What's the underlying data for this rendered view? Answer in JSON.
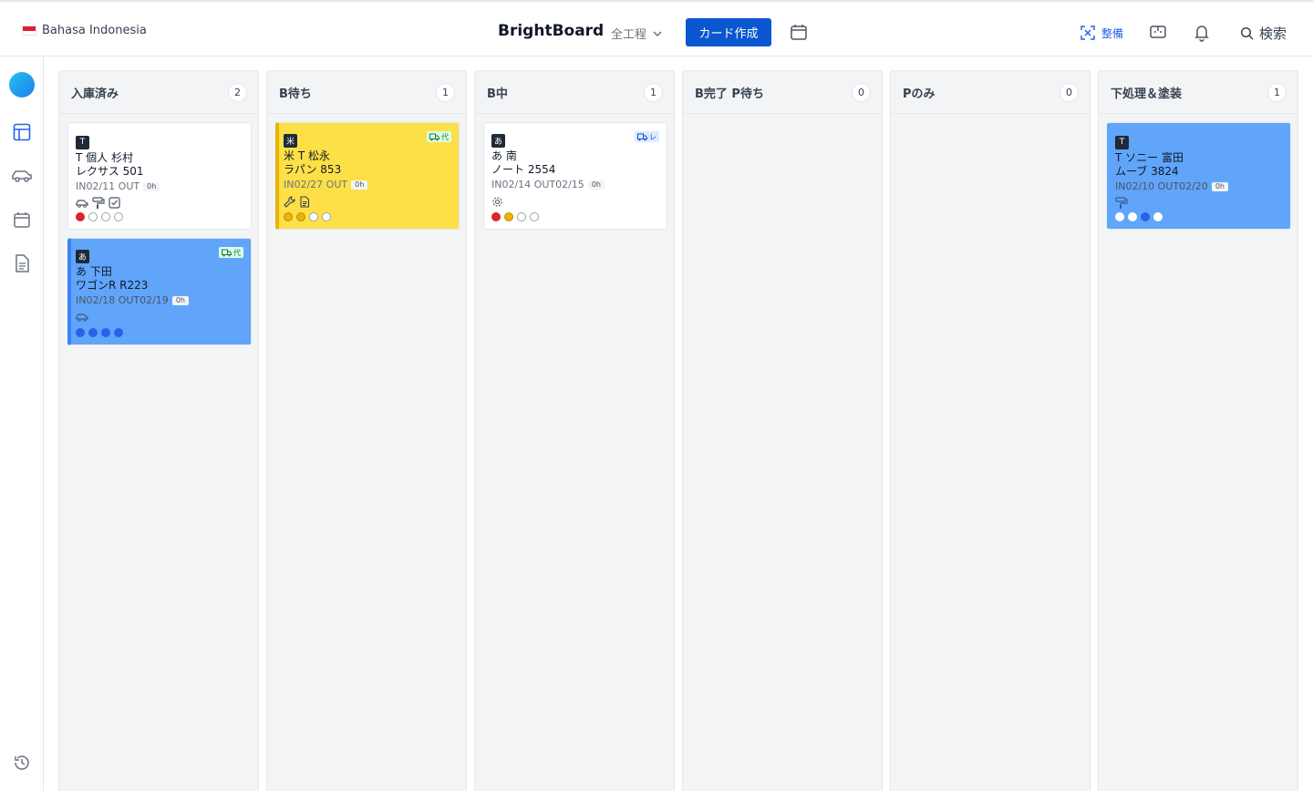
{
  "header": {
    "language": "Bahasa Indonesia",
    "brand": "BrightBoard",
    "stage_filter": "全工程",
    "create_button": "カード作成",
    "maintenance_label": "整備",
    "search_label": "検索"
  },
  "colors": {
    "primary": "#0b57d0",
    "card_yellow": "#fde047",
    "card_blue": "#60a5fa",
    "dot_red": "#dc2626",
    "dot_yellow": "#eab308",
    "dot_blue": "#2563eb"
  },
  "columns": [
    {
      "title": "入庫済み",
      "count": "2",
      "cards": [
        {
          "badge": "T",
          "line1": "T 個人 杉村",
          "line2": "レクサス 501",
          "dates": "IN02/11 OUT",
          "hours": "0h"
        },
        {
          "badge": "あ",
          "tag": "代",
          "line1": "あ 下田",
          "line2": "ワゴンR R223",
          "dates": "IN02/18 OUT02/19",
          "hours": "0h"
        }
      ]
    },
    {
      "title": "B待ち",
      "count": "1",
      "cards": [
        {
          "badge": "米",
          "tag": "代",
          "line1": "米 T 松永",
          "line2": "ラパン 853",
          "dates": "IN02/27 OUT",
          "hours": "0h"
        }
      ]
    },
    {
      "title": "B中",
      "count": "1",
      "cards": [
        {
          "badge": "あ",
          "tag": "レ",
          "line1": "あ 南",
          "line2": "ノート 2554",
          "dates": "IN02/14 OUT02/15",
          "hours": "0h"
        }
      ]
    },
    {
      "title": "B完了 P待ち",
      "count": "0",
      "cards": []
    },
    {
      "title": "Pのみ",
      "count": "0",
      "cards": []
    },
    {
      "title": "下処理＆塗装",
      "count": "1",
      "cards": [
        {
          "badge": "T",
          "line1": "T ソニー 富田",
          "line2": "ムーブ 3824",
          "dates": "IN02/10 OUT02/20",
          "hours": "0h"
        }
      ]
    }
  ]
}
